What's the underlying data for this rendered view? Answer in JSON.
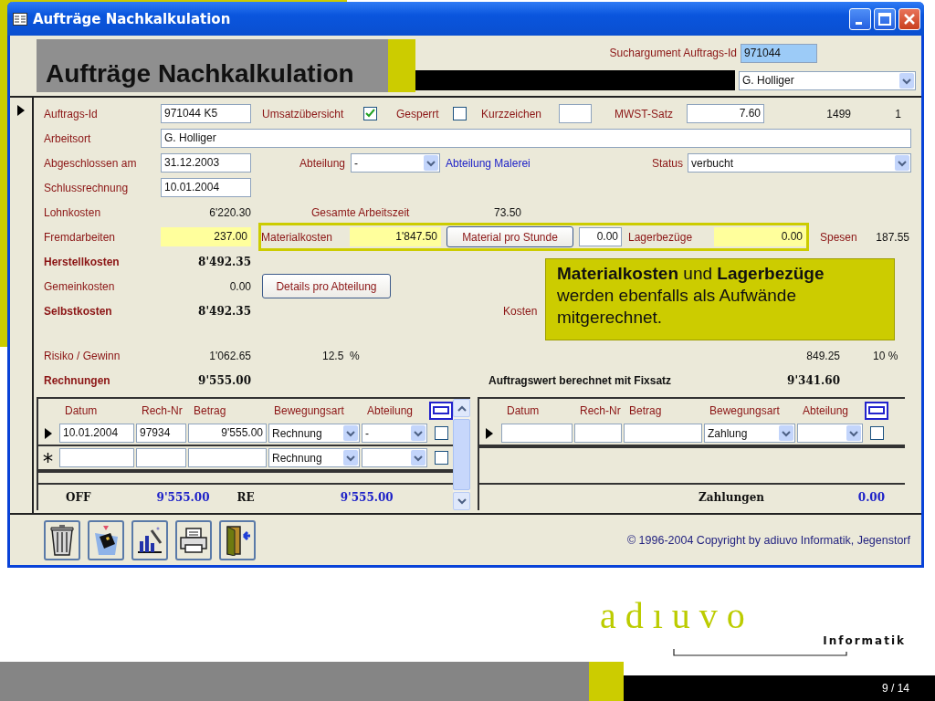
{
  "window": {
    "title": "Aufträge Nachkalkulation"
  },
  "header": {
    "title": "Aufträge Nachkalkulation",
    "search_label": "Suchargument Auftrags-Id",
    "search_value": "971044",
    "person": "G. Holliger"
  },
  "form": {
    "auftrags_id": {
      "label": "Auftrags-Id",
      "value": "971044 K5"
    },
    "umsatz": {
      "label": "Umsatzübersicht",
      "checked": true
    },
    "gesperrt": {
      "label": "Gesperrt",
      "checked": false
    },
    "kurzzeichen": {
      "label": "Kurzzeichen"
    },
    "mwst": {
      "label": "MWST-Satz",
      "value": "7.60"
    },
    "number_1": "1499",
    "number_2": "1",
    "arbeitsort": {
      "label": "Arbeitsort",
      "value": "G. Holliger"
    },
    "abgeschlossen": {
      "label": "Abgeschlossen am",
      "value": "31.12.2003"
    },
    "abteilung": {
      "label": "Abteilung",
      "value": "-",
      "name": "Abteilung Malerei"
    },
    "status": {
      "label": "Status",
      "value": "verbucht"
    },
    "schlussrechnung": {
      "label": "Schlussrechnung",
      "value": "10.01.2004"
    },
    "lohnkosten": {
      "label": "Lohnkosten",
      "value": "6'220.30"
    },
    "arbeitszeit": {
      "label": "Gesamte Arbeitszeit",
      "value": "73.50"
    },
    "fremdarbeiten": {
      "label": "Fremdarbeiten",
      "value": "237.00"
    },
    "materialkosten": {
      "label": "Materialkosten",
      "value": "1'847.50"
    },
    "material_button": "Material pro Stunde",
    "material_pro_stunde": "0.00",
    "lagerbezuege": {
      "label": "Lagerbezüge",
      "value": "0.00"
    },
    "spesen": {
      "label": "Spesen",
      "value": "187.55"
    },
    "herstellkosten": {
      "label": "Herstellkosten",
      "value": "8'492.35"
    },
    "gemeinkosten": {
      "label": "Gemeinkosten",
      "value": "0.00"
    },
    "details_button": "Details pro Abteilung",
    "selbstkosten": {
      "label": "Selbstkosten",
      "value": "8'492.35"
    },
    "kosten_label": "Kosten",
    "risiko": {
      "label": "Risiko / Gewinn",
      "value": "1'062.65",
      "percent": "12.5  %"
    },
    "fixsatz": {
      "value": "849.25",
      "percent": "10 %"
    },
    "rechnungen": {
      "label": "Rechnungen",
      "value": "9'555.00"
    },
    "auftragswert": {
      "label": "Auftragswert berechnet mit Fixsatz",
      "value": "9'341.60"
    }
  },
  "invoices": {
    "columns": [
      "Datum",
      "Rech-Nr",
      "Betrag",
      "Bewegungsart",
      "Abteilung"
    ],
    "rows": [
      {
        "kind": "current",
        "datum": "10.01.2004",
        "rech_nr": "97934",
        "betrag": "9'555.00",
        "bewegungsart": "Rechnung",
        "abteilung": "-",
        "checked": false
      },
      {
        "kind": "new",
        "bewegungsart": "Rechnung",
        "checked": false
      }
    ],
    "footer": [
      {
        "label": "OFF",
        "value": "9'555.00"
      },
      {
        "label": "RE",
        "value": "9'555.00"
      }
    ]
  },
  "payments": {
    "columns": [
      "Datum",
      "Rech-Nr",
      "Betrag",
      "Bewegungsart",
      "Abteilung"
    ],
    "rows": [
      {
        "kind": "current",
        "bewegungsart": "Zahlung",
        "checked": false
      }
    ],
    "footer": [
      {
        "label": "Zahlungen",
        "value": "0.00"
      }
    ]
  },
  "toolbar": [
    {
      "kind": "trash"
    },
    {
      "kind": "card"
    },
    {
      "kind": "chart"
    },
    {
      "kind": "print"
    },
    {
      "kind": "exit"
    }
  ],
  "copyright": "© 1996-2004 Copyright by adiuvo Informatik, Jegenstorf",
  "callout": "**Materialkosten** und **Lagerbezüge** werden ebenfalls als Aufwände mitgerechnet.",
  "slide": {
    "logo": "adıuvo",
    "logo_subtitle": "Informatik",
    "page": "9 / 14"
  }
}
